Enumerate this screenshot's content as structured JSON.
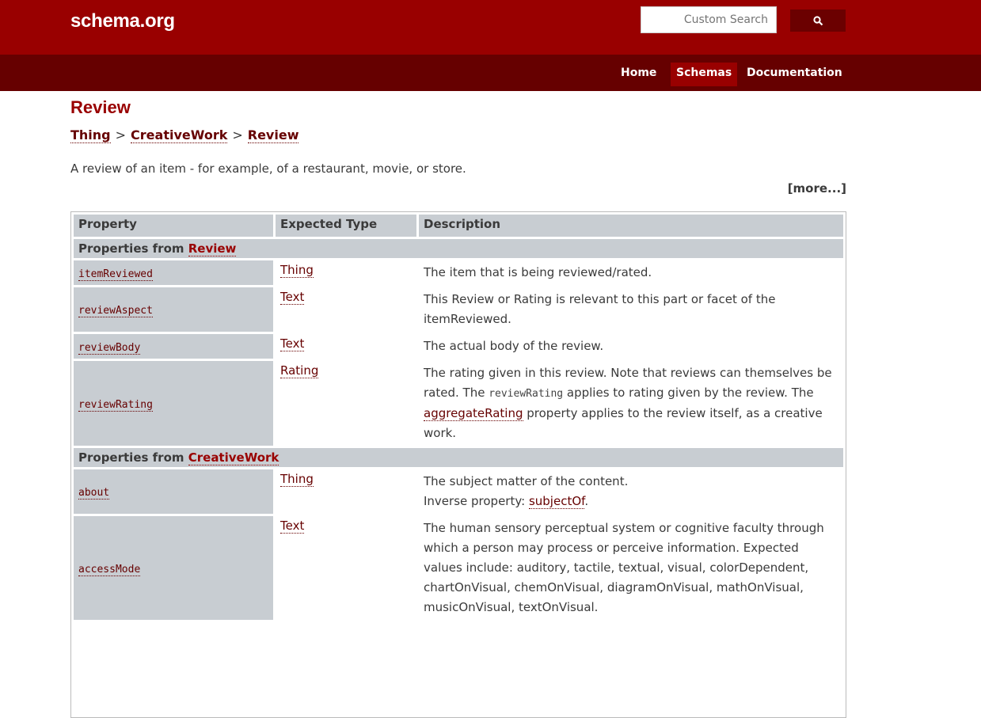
{
  "header": {
    "logo": "schema.org",
    "search_placeholder": "Custom Search",
    "search_icon": "magnifier-icon"
  },
  "nav": {
    "items": [
      {
        "label": "Home"
      },
      {
        "label": "Schemas",
        "active": true
      },
      {
        "label": "Documentation"
      }
    ]
  },
  "page": {
    "title": "Review",
    "breadcrumb": [
      "Thing",
      "CreativeWork",
      "Review"
    ],
    "breadcrumb_separator": ">",
    "description": "A review of an item - for example, of a restaurant, movie, or store.",
    "more_link": "[more...]"
  },
  "table": {
    "headers": [
      "Property",
      "Expected Type",
      "Description"
    ],
    "section_prefix": "Properties from",
    "sections": [
      {
        "name": "Review",
        "rows": [
          {
            "property": "itemReviewed",
            "type": "Thing",
            "description": "The item that is being reviewed/rated."
          },
          {
            "property": "reviewAspect",
            "type": "Text",
            "description": "This Review or Rating is relevant to this part or facet of the itemReviewed."
          },
          {
            "property": "reviewBody",
            "type": "Text",
            "description": "The actual body of the review."
          },
          {
            "property": "reviewRating",
            "type": "Rating",
            "description_parts": {
              "p1": "The rating given in this review. Note that reviews can themselves be rated. The ",
              "code": "reviewRating",
              "p2": " applies to rating given by the review. The ",
              "link": "aggregateRating",
              "p3": " property applies to the review itself, as a creative work."
            }
          }
        ]
      },
      {
        "name": "CreativeWork",
        "rows": [
          {
            "property": "about",
            "type": "Thing",
            "description_parts": {
              "p1": "The subject matter of the content.",
              "inverse_label": "Inverse property: ",
              "link": "subjectOf",
              "end": "."
            }
          },
          {
            "property": "accessMode",
            "type": "Text",
            "description": "The human sensory perceptual system or cognitive faculty through which a person may process or perceive information. Expected values include: auditory, tactile, textual, visual, colorDependent, chartOnVisual, chemOnVisual, diagramOnVisual, mathOnVisual, musicOnVisual, textOnVisual."
          }
        ]
      }
    ]
  }
}
